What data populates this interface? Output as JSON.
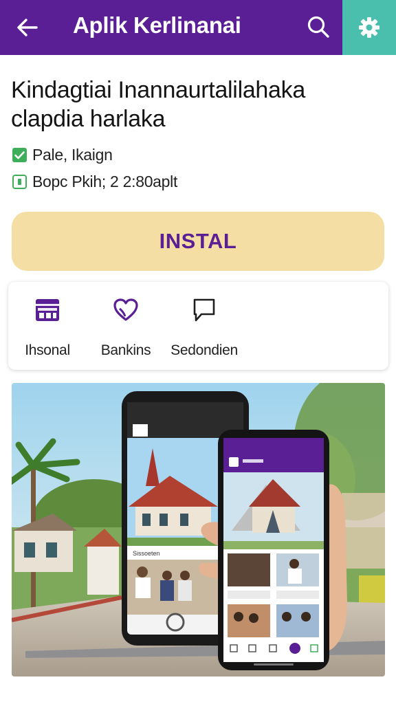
{
  "appbar": {
    "title": "Aplik Kerlinanai",
    "back_icon": "arrow-left-icon",
    "search_icon": "search-icon",
    "settings_icon": "gear-icon",
    "color": "#5a1f94",
    "accent_color": "#4bbfae"
  },
  "app": {
    "name": "Kindagtiai Inannaurtalilahaka clapdia harlaka",
    "meta_1": "Pale, Ikaign",
    "meta_2": "Bopc Pkih; 2 2:80aplt"
  },
  "install": {
    "label": "INSTAL",
    "color": "#f4dea3"
  },
  "actions": [
    {
      "label": "Ihsonal",
      "icon": "store-icon"
    },
    {
      "label": "Bankins",
      "icon": "heart-icon"
    },
    {
      "label": "Sedondien",
      "icon": "chat-icon"
    }
  ],
  "hero": {
    "front_phone_label": "Sissoeten",
    "image": "phones-showing-traditional-house-app"
  }
}
